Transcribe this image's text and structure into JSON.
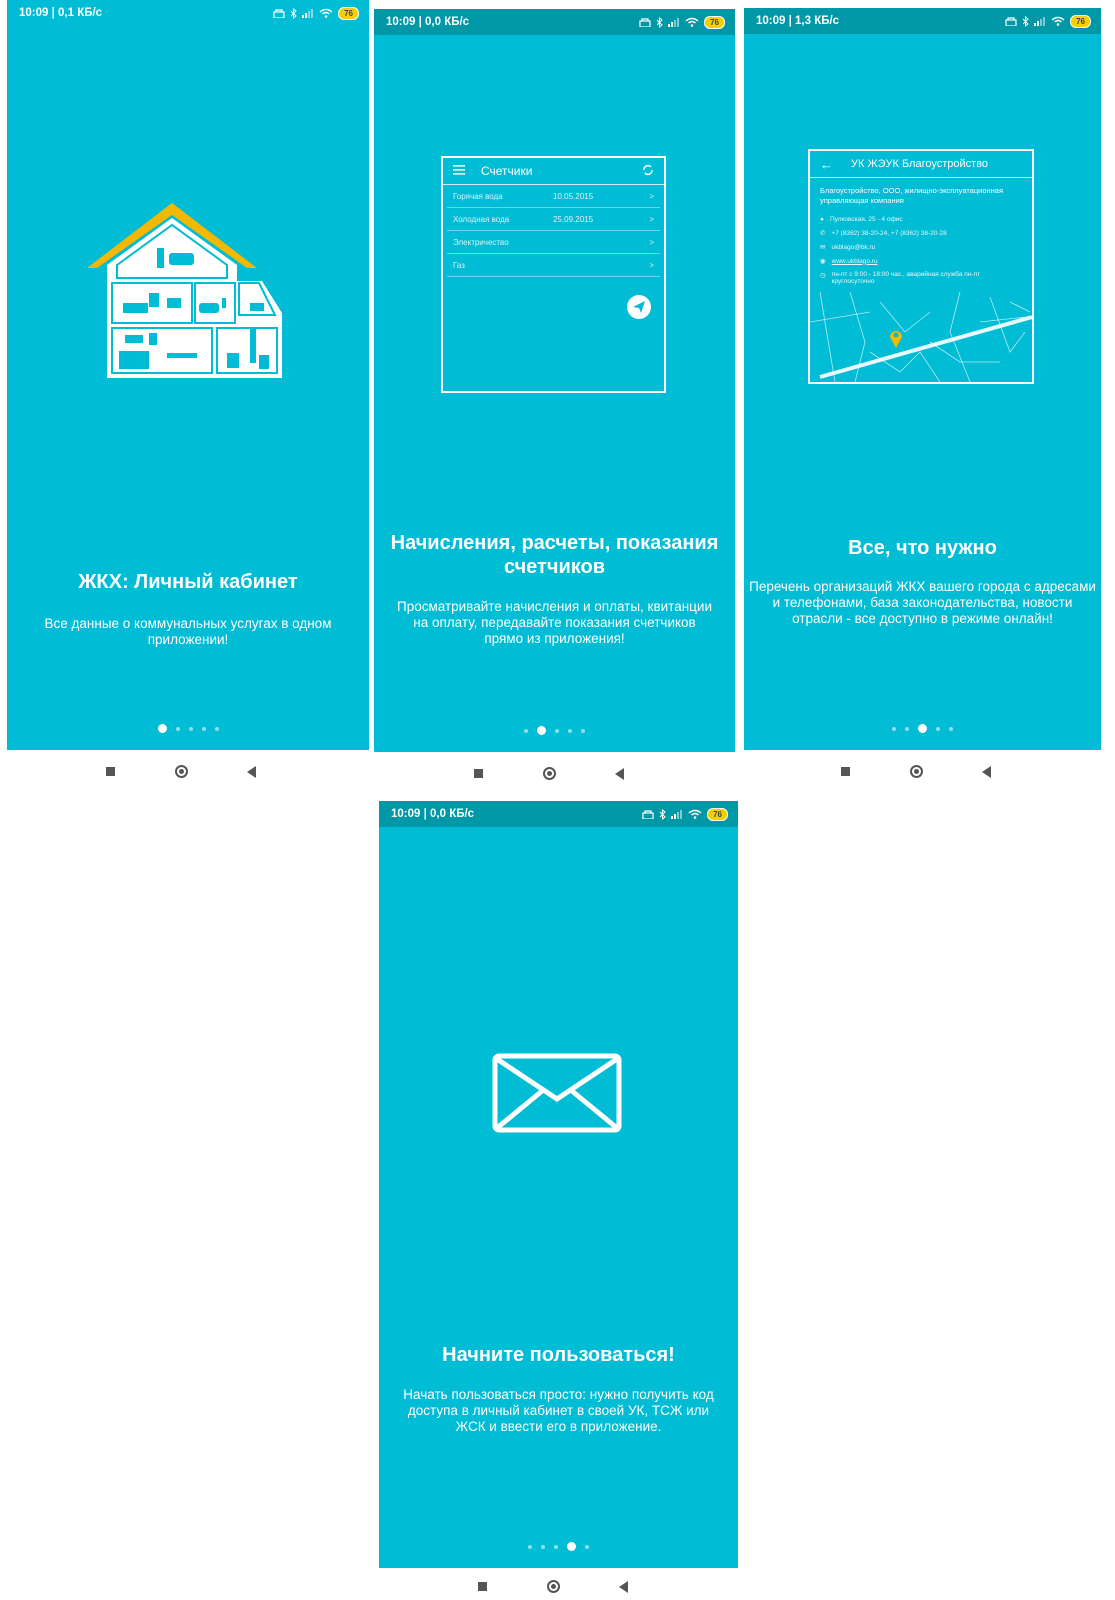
{
  "colors": {
    "primary": "#00bcd4",
    "status_dark": "#0097a7",
    "roof": "#f5b800",
    "pin": "#f5b800"
  },
  "screens": [
    {
      "status": {
        "time": "10:09 | 0,1 КБ/с",
        "battery": "76"
      },
      "title": "ЖКХ: Личный кабинет",
      "desc": "Все данные о коммунальных услугах в одном приложении!",
      "active_dot": 0
    },
    {
      "status": {
        "time": "10:09 | 0,0 КБ/с",
        "battery": "76"
      },
      "title": "Начисления, расчеты, показания счетчиков",
      "desc": "Просматривайте начисления и оплаты, квитанции на оплату, передавайте показания счетчиков прямо из приложения!",
      "active_dot": 1,
      "mockup": {
        "header": "Счетчики",
        "rows": [
          {
            "name": "Горячая вода",
            "date": "10.05.2015",
            "arrow": ">"
          },
          {
            "name": "Холодная вода",
            "date": "25.09.2015",
            "arrow": ">"
          },
          {
            "name": "Электричество",
            "date": "",
            "arrow": ">"
          },
          {
            "name": "Газ",
            "date": "",
            "arrow": ">"
          }
        ]
      }
    },
    {
      "status": {
        "time": "10:09 | 1,3 КБ/с",
        "battery": "76"
      },
      "title": "Все, что нужно",
      "desc": "Перечень организаций ЖКХ вашего города с адресами и телефонами, база законодательства, новости отрасли - все доступно в режиме онлайн!",
      "active_dot": 2,
      "mockup": {
        "back_arrow": "←",
        "header": "УК ЖЭУК Благоустройство",
        "org": "Благоустройство, ООО, жилищно-эксплуатационная управляющая компания",
        "address": "Пулковская, 25 - 4 офис",
        "phone": "+7 (8362) 38-20-24, +7 (8362) 38-20-28",
        "email": "ukblago@bk.ru",
        "site": "www.ukblago.ru",
        "hours": "пн-пт с 9:00 - 18:00 час., аварийная служба пн-пт круглосуточно"
      }
    },
    {
      "status": {
        "time": "10:09 | 0,0 КБ/с",
        "battery": "76"
      },
      "title": "Начните пользоваться!",
      "desc": "Начать пользоваться просто: нужно получить код доступа в личный кабинет в своей УК, ТСЖ или ЖСК и ввести его в приложение.",
      "active_dot": 3
    }
  ]
}
